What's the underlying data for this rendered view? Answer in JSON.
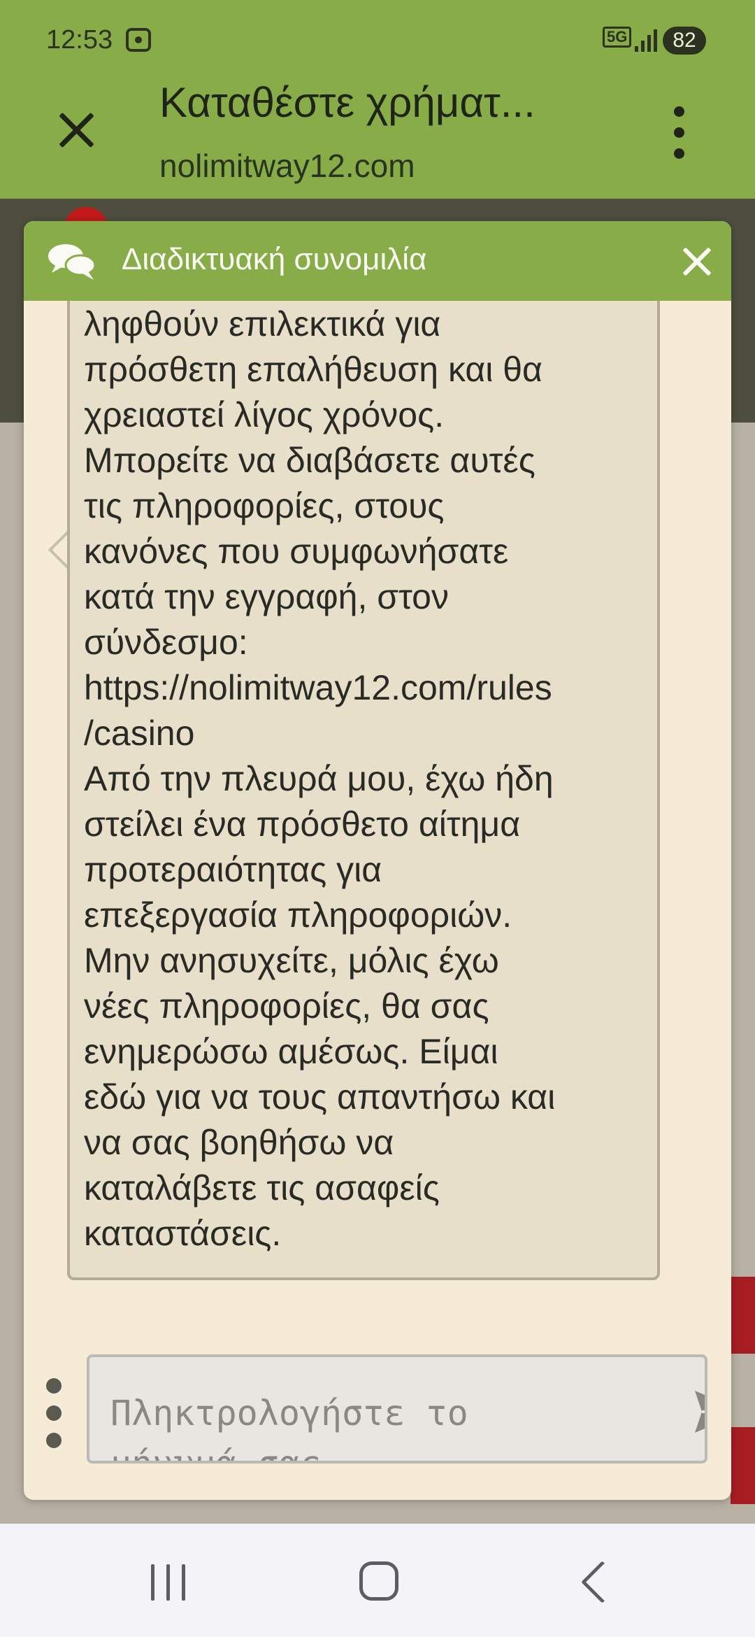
{
  "status_bar": {
    "time": "12:53",
    "network": "5G",
    "battery": "82"
  },
  "browser": {
    "page_title": "Καταθέστε χρήματ...",
    "url": "nolimitway12.com",
    "close_icon": "close-icon",
    "menu_icon": "more-vert-icon"
  },
  "chat": {
    "title": "Διαδικτυακή συνομιλία",
    "header_icon": "chat-bubbles-icon",
    "close_icon": "close-icon",
    "message": "λογαριασμοί μπορούν να\nληφθούν επιλεκτικά για\nπρόσθετη επαλήθευση και θα\nχρειαστεί λίγος χρόνος.\nΜπορείτε να διαβάσετε αυτές\nτις πληροφορίες, στους\nκανόνες που συμφωνήσατε\nκατά την εγγραφή, στον\nσύνδεσμο:\nhttps://nolimitway12.com/rules\n/casino\nΑπό την πλευρά μου, έχω ήδη\nστείλει ένα πρόσθετο αίτημα\nπροτεραιότητας για\nεπεξεργασία πληροφοριών.\nΜην ανησυχείτε, μόλις έχω\nνέες πληροφορίες, θα σας\nενημερώσω αμέσως. Είμαι\nεδώ για να τους απαντήσω και\nνα σας βοηθήσω να\nκαταλάβετε τις ασαφείς\nκαταστάσεις.",
    "input_placeholder": "Πληκτρολογήστε το μήνυμά σας",
    "send_icon": "send-icon"
  },
  "colors": {
    "header_green": "#88ad48",
    "chat_background": "#f5ebd7",
    "bubble_background": "#e8dfcb"
  }
}
